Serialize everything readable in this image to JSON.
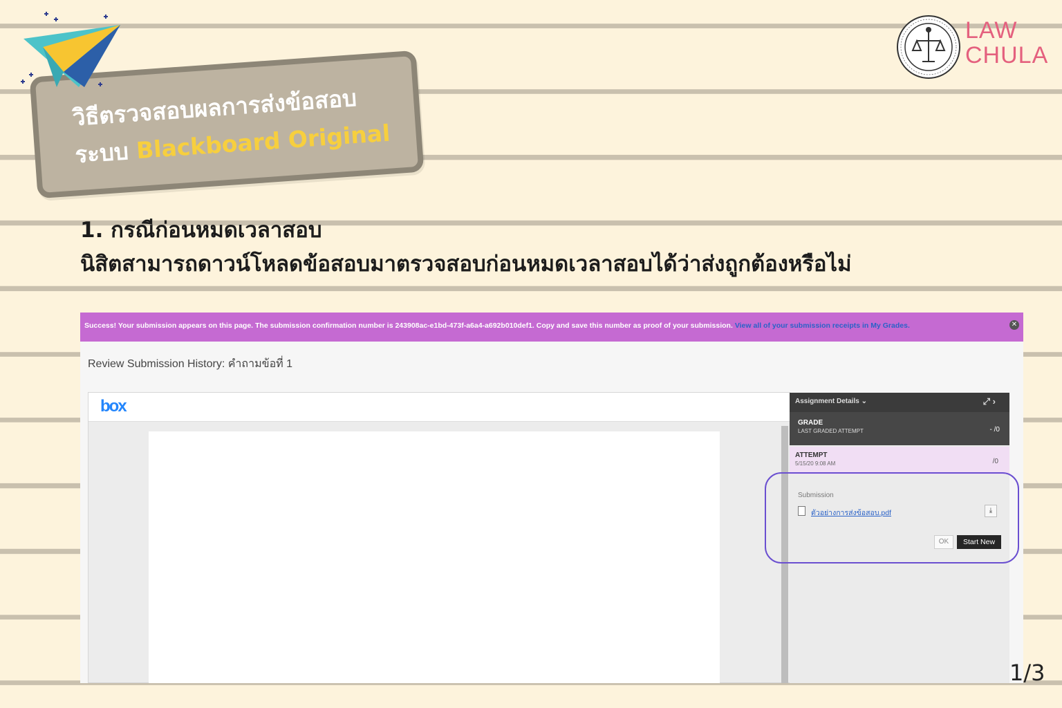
{
  "title_card": {
    "line1": "วิธีตรวจสอบผลการส่งข้อสอบ",
    "line2_prefix": "ระบบ",
    "line2_highlight": "Blackboard Original"
  },
  "logo": {
    "line1": "LAW",
    "line2": "CHULA"
  },
  "heading": {
    "line1": "1. กรณีก่อนหมดเวลาสอบ",
    "line2": "นิสิตสามารถดาวน์โหลดข้อสอบมาตรวจสอบก่อนหมดเวลาสอบได้ว่าส่งถูกต้องหรือไม่"
  },
  "screenshot": {
    "banner": {
      "text": "Success! Your submission appears on this page. The submission confirmation number is 243908ac-e1bd-473f-a6a4-a692b010def1. Copy and save this number as proof of your submission.",
      "link": "View all of your submission receipts in My Grades."
    },
    "page_title": "Review Submission History: คำถามข้อที่ 1",
    "viewer_logo": "box",
    "panel": {
      "header": "Assignment Details ⌄",
      "grade_title": "GRADE",
      "grade_sub": "LAST GRADED ATTEMPT",
      "grade_value": "- /0",
      "attempt_title": "ATTEMPT",
      "attempt_date": "5/15/20 9:08 AM",
      "attempt_value": "/0",
      "submission_label": "Submission",
      "file_name": "ตัวอย่างการส่งข้อสอบ.pdf",
      "ok_label": "OK",
      "start_new_label": "Start New"
    }
  },
  "page_indicator": "1/3",
  "colors": {
    "background": "#fdf3dc",
    "banner": "#c56ad2",
    "highlight_outline": "#6a4fd0",
    "logo": "#e4607e",
    "title_highlight": "#f7cf3e"
  }
}
